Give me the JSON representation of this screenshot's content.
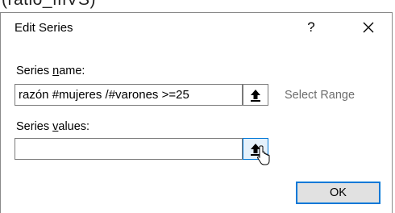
{
  "background": {
    "partial_text": "(ratio_ffiVS)"
  },
  "dialog": {
    "title": "Edit Series",
    "help_label": "?",
    "close_icon": "close-icon"
  },
  "series_name": {
    "label_prefix": "Series ",
    "label_accel": "n",
    "label_suffix": "ame:",
    "value": "razón #mujeres /#varones >=25",
    "range_icon": "collapse-range-icon",
    "select_range_text": "Select Range"
  },
  "series_values": {
    "label_prefix": "Series ",
    "label_accel": "v",
    "label_suffix": "alues:",
    "value": "",
    "range_icon": "collapse-range-icon"
  },
  "buttons": {
    "ok_label": "OK"
  },
  "colors": {
    "accent": "#0078d7",
    "border": "#7a7a7a",
    "muted_text": "#6d6d6d"
  }
}
